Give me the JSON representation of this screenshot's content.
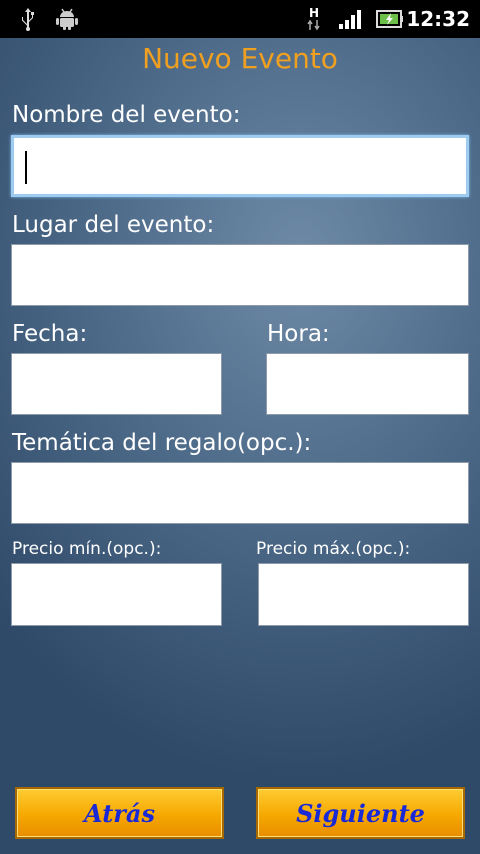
{
  "status_bar": {
    "time": "12:32",
    "network_type": "H",
    "icons": [
      "usb-icon",
      "android-debug-icon",
      "data-transfer-icon",
      "signal-icon",
      "battery-icon"
    ]
  },
  "screen": {
    "title": "Nuevo Evento",
    "title_color": "#f0a020"
  },
  "form": {
    "event_name_label": "Nombre del evento:",
    "event_name_value": "",
    "place_label": "Lugar del evento:",
    "place_value": "",
    "date_label": "Fecha:",
    "date_value": "",
    "time_label": "Hora:",
    "time_value": "",
    "theme_label": "Temática del regalo(opc.):",
    "theme_value": "",
    "min_price_label": "Precio mín.(opc.):",
    "min_price_value": "",
    "max_price_label": "Precio máx.(opc.):",
    "max_price_value": ""
  },
  "buttons": {
    "back_label": "Atrás",
    "next_label": "Siguiente",
    "color": "#f6a800",
    "text_color": "#1a29d6"
  }
}
